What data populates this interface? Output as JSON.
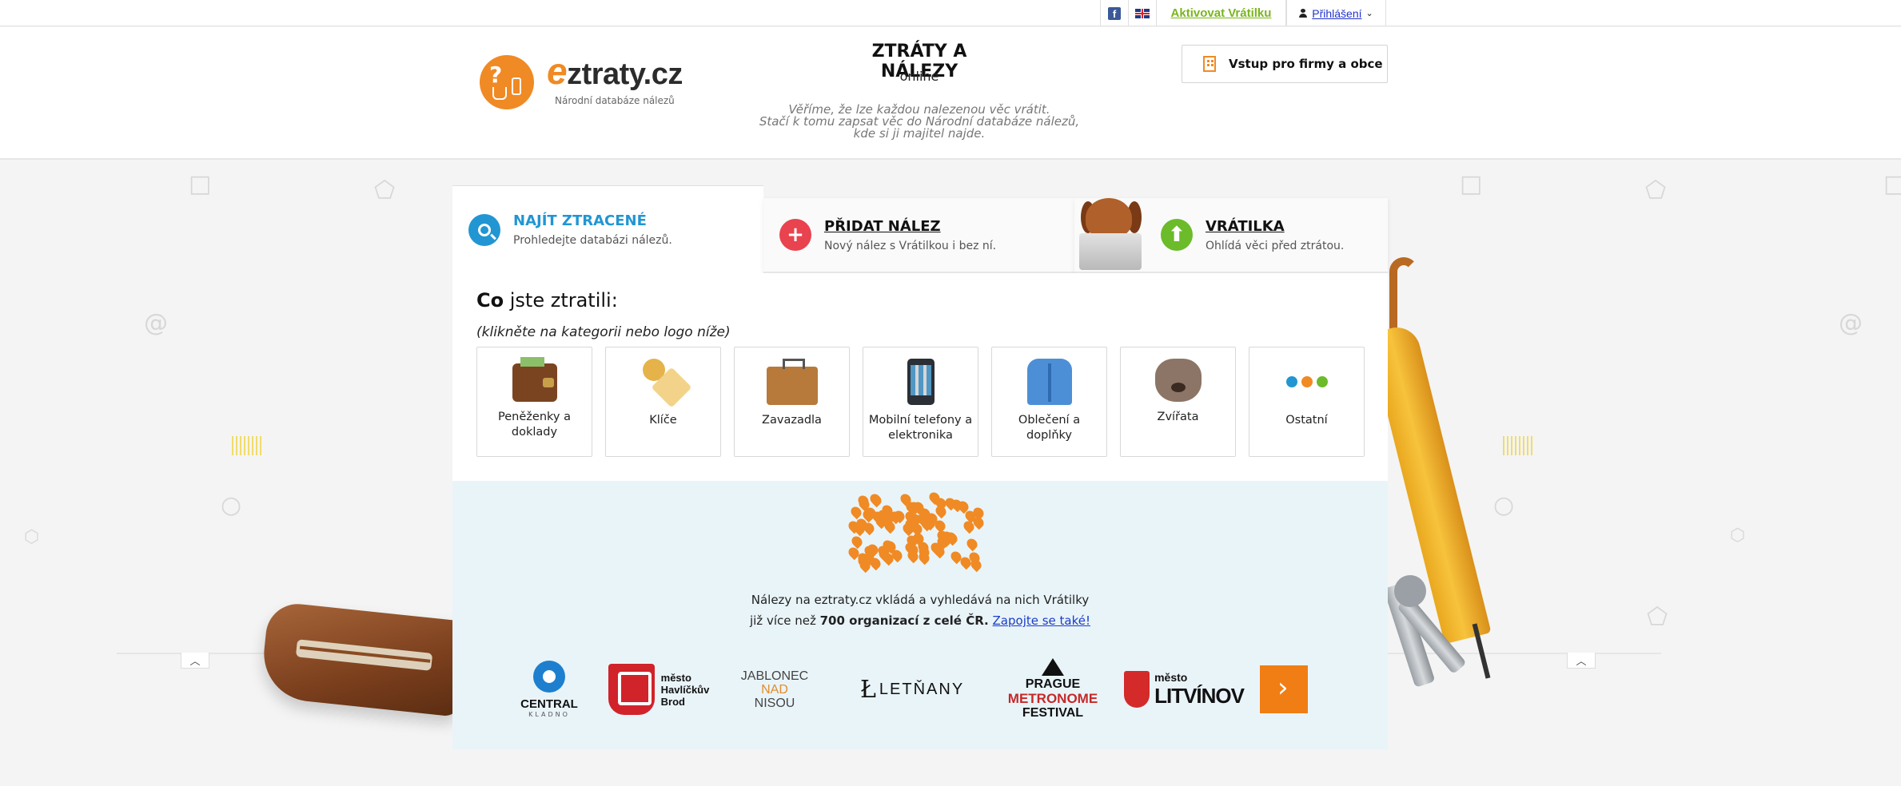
{
  "topbar": {
    "activate_label": "Aktivovat Vrátilku",
    "login_label": "Přihlášení",
    "fb_glyph": "f"
  },
  "header": {
    "logo_e": "e",
    "logo_rest": "ztraty.cz",
    "logo_sub": "Národní databáze nálezů",
    "title": "ZTRÁTY A NÁLEZY",
    "online": "online",
    "slogan_1": "Věříme, že lze každou nalezenou věc vrátit.",
    "slogan_2": "Stačí k tomu zapsat věc do Národní databáze nálezů,",
    "slogan_3": "kde si ji majitel najde.",
    "firms_button": "Vstup pro firmy a obce"
  },
  "tabs": [
    {
      "title": "NAJÍT ZTRACENÉ",
      "subtitle": "Prohledejte databázi nálezů.",
      "active": true
    },
    {
      "title": "PŘIDAT NÁLEZ",
      "subtitle": "Nový nález s Vrátilkou i bez ní.",
      "active": false
    },
    {
      "title": "VRÁTILKA",
      "subtitle": "Ohlídá věci před ztrátou.",
      "active": false
    }
  ],
  "panel": {
    "question_bold": "Co",
    "question_rest": " jste ztratili:",
    "hint": "(klikněte na kategorii nebo logo níže)"
  },
  "categories": [
    {
      "label": "Peněženky a doklady",
      "icon": "wallet-icon"
    },
    {
      "label": "Klíče",
      "icon": "keys-icon"
    },
    {
      "label": "Zavazadla",
      "icon": "suitcase-icon"
    },
    {
      "label": "Mobilní telefony a elektronika",
      "icon": "phone-icon"
    },
    {
      "label": "Oblečení a doplňky",
      "icon": "jacket-icon"
    },
    {
      "label": "Zvířata",
      "icon": "dog-icon"
    },
    {
      "label": "Ostatní",
      "icon": "dots-icon"
    }
  ],
  "lower": {
    "info_line1": "Nálezy na eztraty.cz vkládá a vyhledává na nich Vrátilky",
    "info_line2_pre": "již více než ",
    "info_line2_bold": "700 organizací z celé ČR.",
    "info_link": "Zapojte se také!"
  },
  "partners": {
    "central_name": "CENTRAL",
    "central_sub": "KLADNO",
    "hb_line1": "město",
    "hb_line2": "Havlíčkův",
    "hb_line3": "Brod",
    "jab_1": "JABLONEC",
    "jab_2": "NAD",
    "jab_3": "NISOU",
    "letnany": "LETŇANY",
    "prague_1": "PRAGUE",
    "prague_2": "METRONOME",
    "prague_3": "FESTIVAL",
    "lit_small": "město",
    "lit_big": "LITVÍNOV"
  },
  "colors": {
    "brand_orange": "#f08a24",
    "search_blue": "#2196d3",
    "add_red": "#e8434f",
    "vratilka_green": "#6cbb2a",
    "activate_green": "#7ab51d",
    "lower_bg": "#e9f4f9"
  },
  "dots": [
    "#2196d3",
    "#f08a24",
    "#6cbb2a"
  ]
}
